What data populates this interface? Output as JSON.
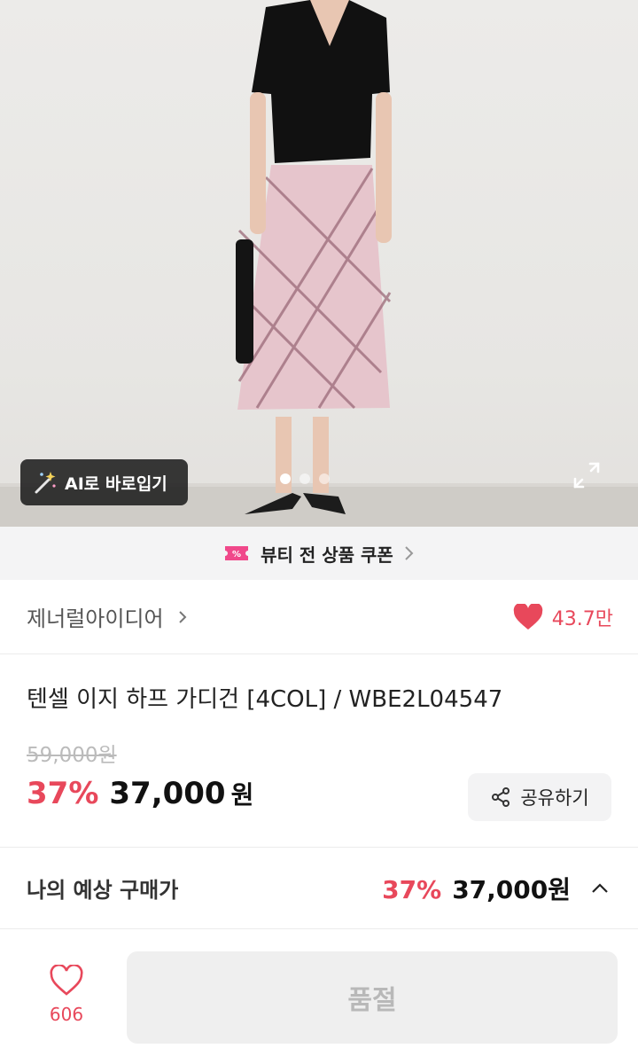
{
  "hero": {
    "ai_button_label": "AI로 바로입기",
    "carousel_count": 3,
    "carousel_active_index": 0
  },
  "coupon": {
    "label": "뷰티 전 상품 쿠폰"
  },
  "brand": {
    "name": "제너럴아이디어",
    "likes": "43.7만"
  },
  "product": {
    "title": "텐셀 이지 하프 가디건 [4COL] / WBE2L04547",
    "original_price": "59,000원",
    "discount": "37%",
    "price": "37,000",
    "currency": "원",
    "share_label": "공유하기"
  },
  "expected_price": {
    "label": "나의 예상 구매가",
    "discount": "37%",
    "amount": "37,000원"
  },
  "bottom_bar": {
    "wish_count": "606",
    "soldout_label": "품절"
  },
  "colors": {
    "accent": "#e8485b",
    "coupon_icon": "#f0488a"
  }
}
